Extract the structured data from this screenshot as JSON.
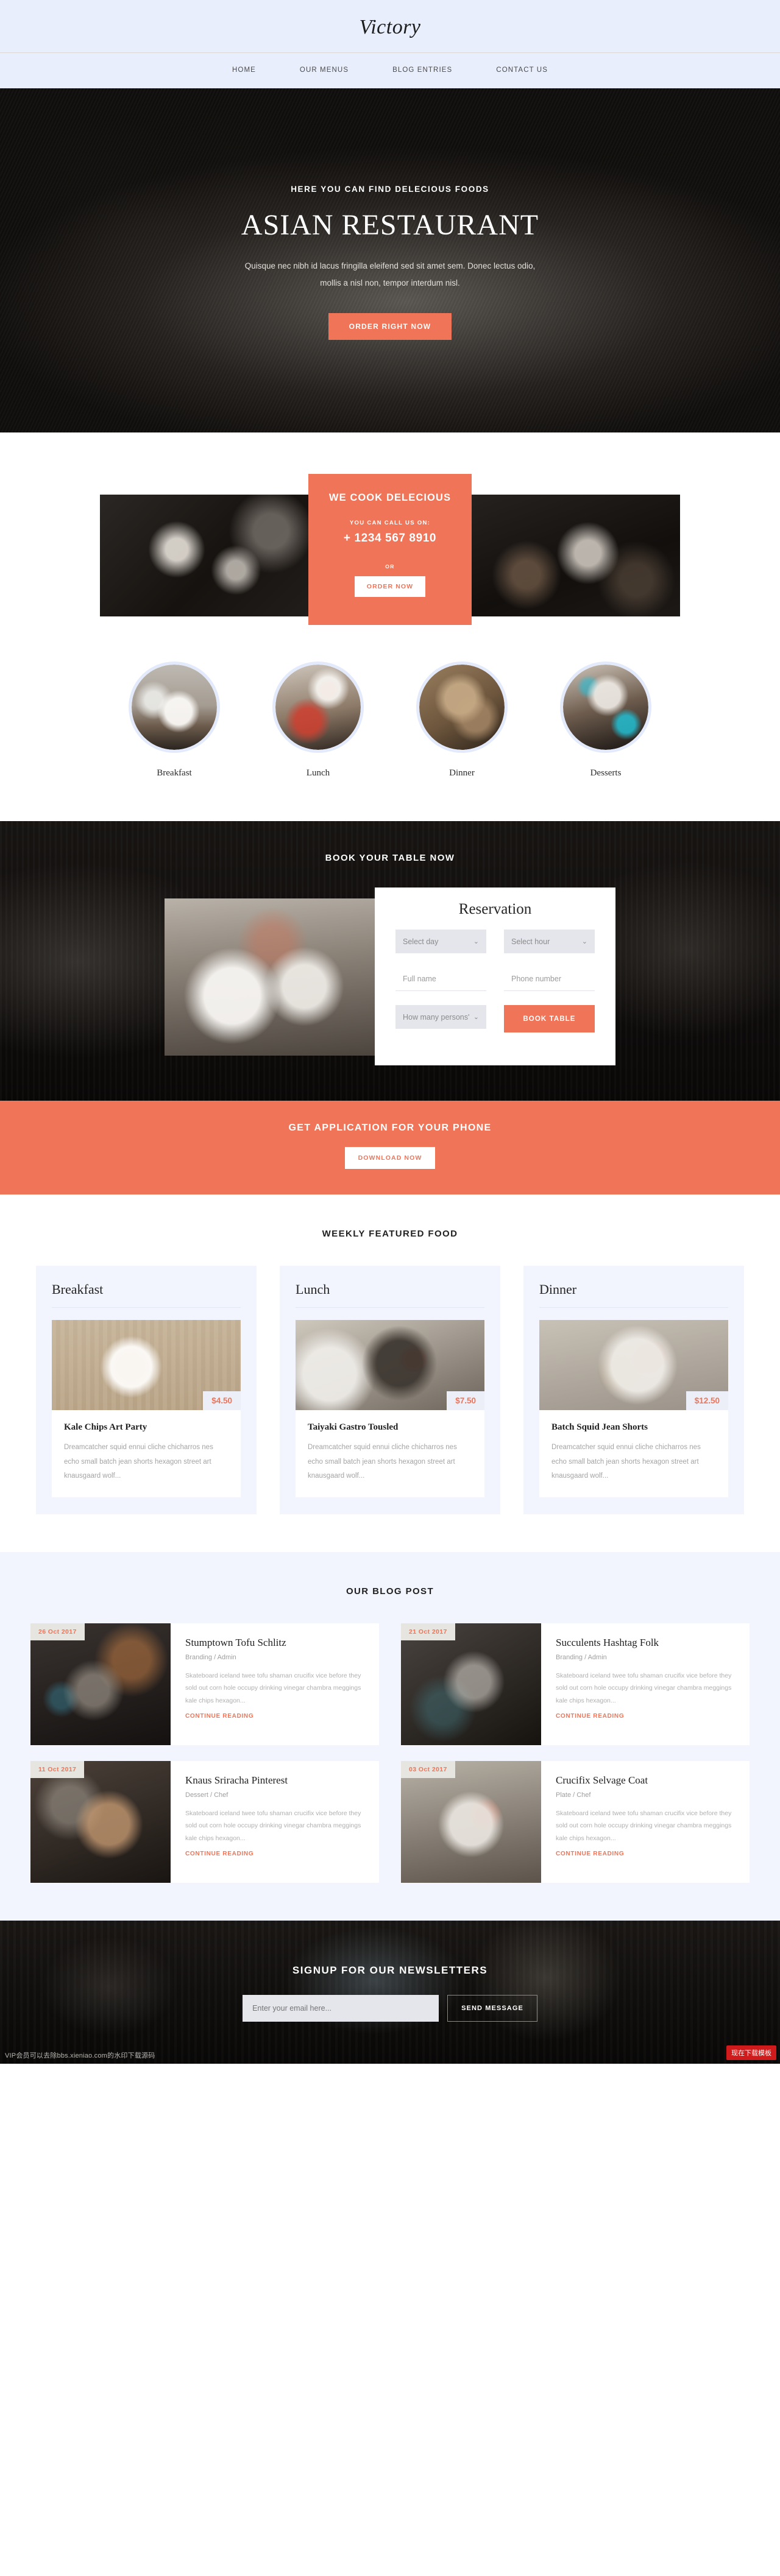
{
  "header": {
    "logo": "Victory",
    "nav": [
      {
        "label": "HOME"
      },
      {
        "label": "OUR MENUS"
      },
      {
        "label": "BLOG ENTRIES"
      },
      {
        "label": "CONTACT US"
      }
    ]
  },
  "hero": {
    "kicker": "HERE YOU CAN FIND DELECIOUS FOODS",
    "title": "ASIAN RESTAURANT",
    "subtitle": "Quisque nec nibh id lacus fringilla eleifend sed sit amet sem. Donec lectus odio, mollis a nisl non, tempor interdum nisl.",
    "cta": "ORDER RIGHT NOW"
  },
  "cook": {
    "title": "WE COOK DELECIOUS",
    "call_label": "YOU CAN CALL US ON:",
    "phone": "+ 1234 567 8910",
    "or": "OR",
    "cta": "ORDER NOW"
  },
  "categories": [
    {
      "label": "Breakfast"
    },
    {
      "label": "Lunch"
    },
    {
      "label": "Dinner"
    },
    {
      "label": "Desserts"
    }
  ],
  "booking": {
    "title": "BOOK YOUR TABLE NOW",
    "form_title": "Reservation",
    "select_day": "Select day",
    "select_hour": "Select hour",
    "full_name_placeholder": "Full name",
    "phone_placeholder": "Phone number",
    "persons": "How many persons'",
    "submit": "BOOK TABLE",
    "chevron": "⌄"
  },
  "app": {
    "title": "GET APPLICATION FOR YOUR PHONE",
    "cta": "DOWNLOAD NOW"
  },
  "weekly": {
    "title": "WEEKLY FEATURED FOOD",
    "cards": [
      {
        "group": "Breakfast",
        "price": "$4.50",
        "name": "Kale Chips Art Party",
        "text": "Dreamcatcher squid ennui cliche chicharros nes echo small batch jean shorts hexagon street art knausgaard wolf..."
      },
      {
        "group": "Lunch",
        "price": "$7.50",
        "name": "Taiyaki Gastro Tousled",
        "text": "Dreamcatcher squid ennui cliche chicharros nes echo small batch jean shorts hexagon street art knausgaard wolf..."
      },
      {
        "group": "Dinner",
        "price": "$12.50",
        "name": "Batch Squid Jean Shorts",
        "text": "Dreamcatcher squid ennui cliche chicharros nes echo small batch jean shorts hexagon street art knausgaard wolf..."
      }
    ]
  },
  "blog": {
    "title": "OUR BLOG POST",
    "read_more": "CONTINUE READING",
    "posts": [
      {
        "date": "26 Oct 2017",
        "title": "Stumptown Tofu Schlitz",
        "meta": "Branding / Admin",
        "text": "Skateboard iceland twee tofu shaman crucifix vice before they sold out corn hole occupy drinking vinegar chambra meggings kale chips hexagon..."
      },
      {
        "date": "21 Oct 2017",
        "title": "Succulents Hashtag Folk",
        "meta": "Branding / Admin",
        "text": "Skateboard iceland twee tofu shaman crucifix vice before they sold out corn hole occupy drinking vinegar chambra meggings kale chips hexagon..."
      },
      {
        "date": "11 Oct 2017",
        "title": "Knaus Sriracha Pinterest",
        "meta": "Dessert / Chef",
        "text": "Skateboard iceland twee tofu shaman crucifix vice before they sold out corn hole occupy drinking vinegar chambra meggings kale chips hexagon..."
      },
      {
        "date": "03 Oct 2017",
        "title": "Crucifix Selvage Coat",
        "meta": "Plate / Chef",
        "text": "Skateboard iceland twee tofu shaman crucifix vice before they sold out corn hole occupy drinking vinegar chambra meggings kale chips hexagon..."
      }
    ]
  },
  "newsletter": {
    "title": "SIGNUP FOR OUR NEWSLETTERS",
    "placeholder": "Enter your email here...",
    "submit": "SEND MESSAGE"
  },
  "watermarks": {
    "left": "VIP会员可以去除bbs.xieniao.com的水印下载源码",
    "badge": "现在下载模板"
  },
  "colors": {
    "accent": "#ef7458",
    "header_bg": "#e9eefc",
    "panel_bg": "#f2f5fe",
    "field_bg": "#e4e6ec"
  }
}
